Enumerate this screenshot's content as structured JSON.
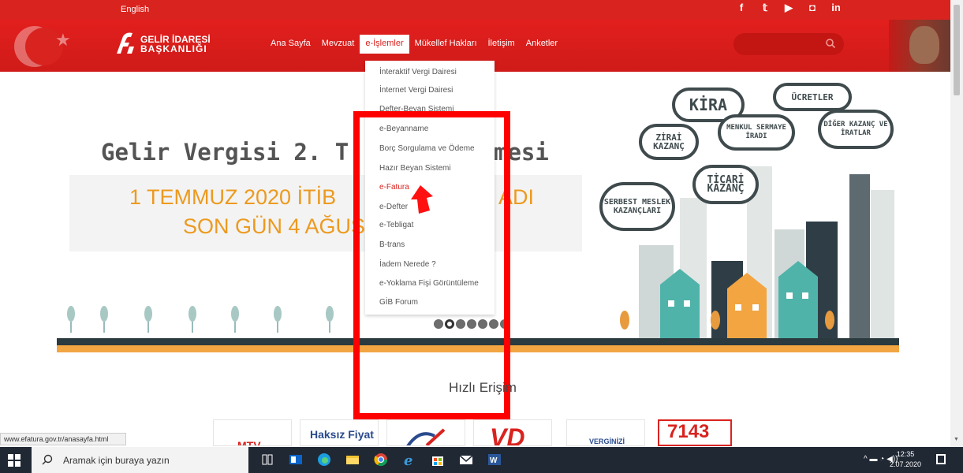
{
  "topbar": {
    "language": "English",
    "social": [
      "f",
      "𝕥",
      "▶",
      "◘",
      "in"
    ]
  },
  "header": {
    "logo_line1": "GELİR İDARESİ",
    "logo_line2": "BAŞKANLIĞI",
    "nav": [
      "Ana Sayfa",
      "Mevzuat",
      "e-İşlemler",
      "Mükellef Hakları",
      "İletişim",
      "Anketler"
    ],
    "active_nav": "e-İşlemler",
    "search_placeholder": ""
  },
  "banner": {
    "title_left": "Gelir Vergisi 2. T",
    "title_right": "mesi",
    "line1": "1 TEMMUZ 2020 İTİB",
    "line1_right": "ADI",
    "line2": "SON GÜN 4 AĞUS",
    "bubbles": [
      "KİRA",
      "ÜCRETLER",
      "ZİRAİ KAZANÇ",
      "MENKUL SERMAYE İRADI",
      "DİĞER KAZANÇ VE İRATLAR",
      "TİCARİ KAZANÇ",
      "SERBEST MESLEK KAZANÇLARI"
    ]
  },
  "dropdown": {
    "items": [
      "İnteraktif Vergi Dairesi",
      "İnternet Vergi Dairesi",
      "Defter-Beyan Sistemi",
      "e-Beyanname",
      "Borç Sorgulama ve Ödeme",
      "Hazır Beyan Sistemi",
      "e-Fatura",
      "e-Defter",
      "e-Tebligat",
      "B-trans",
      "İadem Nerede ?",
      "e-Yoklama Fişi Görüntüleme",
      "GİB Forum"
    ],
    "selected": "e-Fatura"
  },
  "quick_access": {
    "title": "Hızlı Erişim",
    "tiles": [
      "MTV",
      "Haksız Fiyat",
      "",
      "VD",
      "VERGİNİZİ",
      "7143"
    ]
  },
  "status_url": "www.efatura.gov.tr/anasayfa.html",
  "taskbar": {
    "search_placeholder": "Aramak için buraya yazın",
    "time": "12:35",
    "date": "2.07.2020"
  },
  "colors": {
    "brand_red": "#d9231f",
    "banner_orange": "#ec9a1f",
    "taskbar": "#202834"
  }
}
